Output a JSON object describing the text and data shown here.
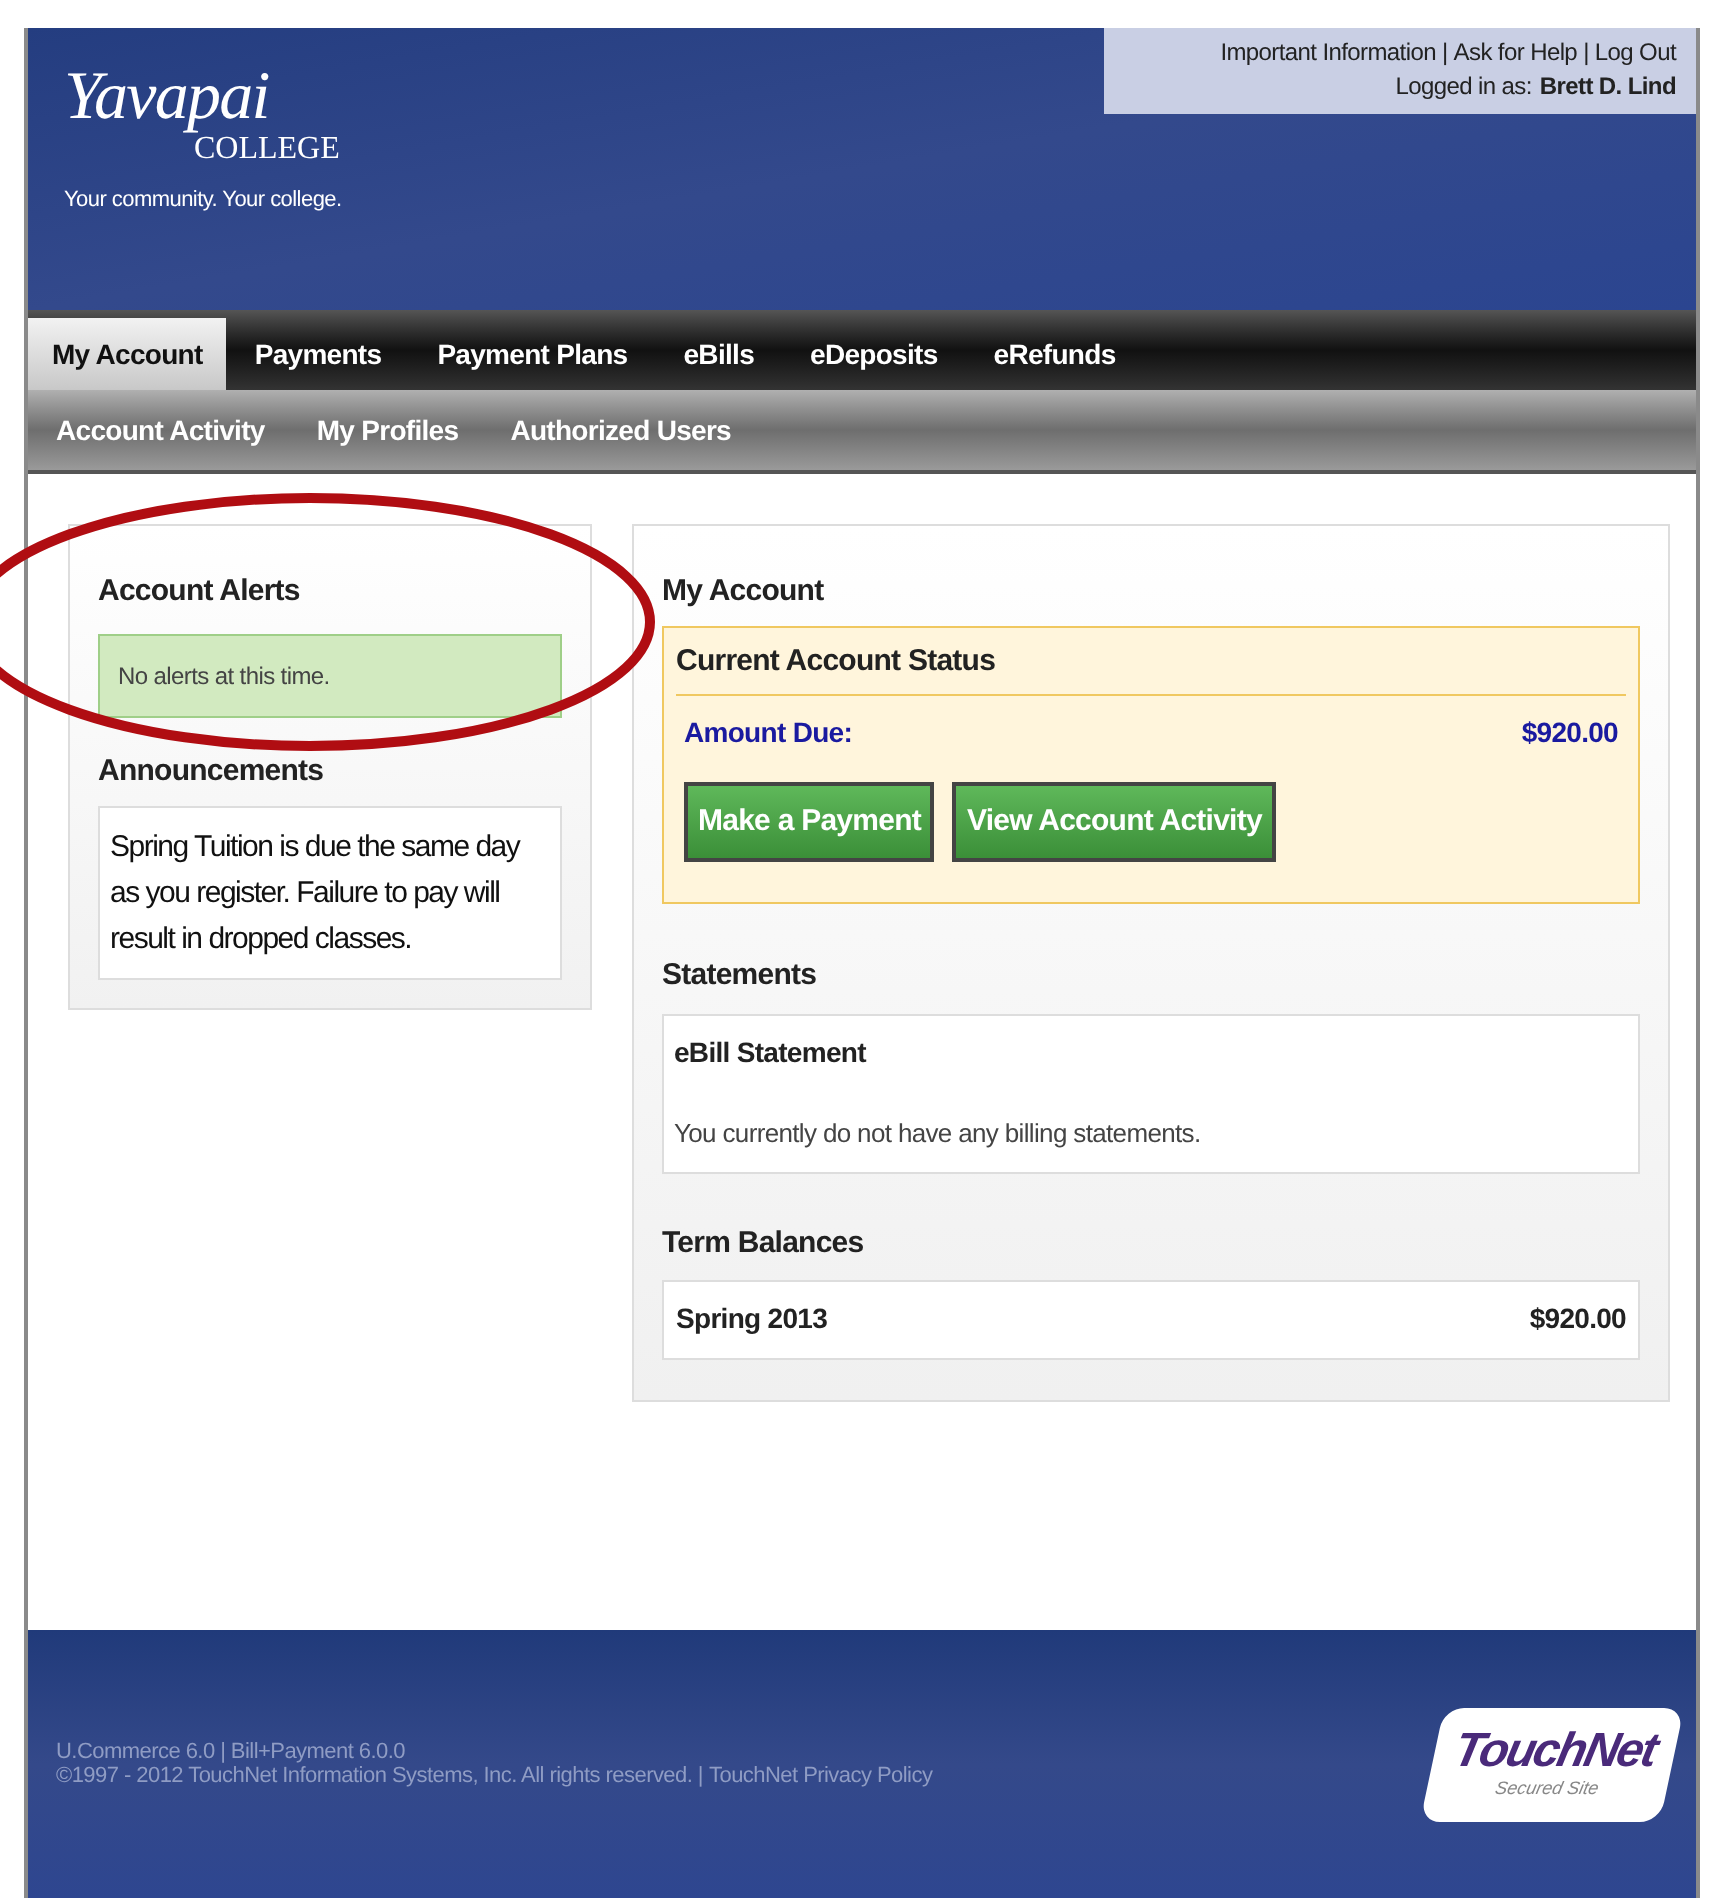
{
  "header": {
    "logo": {
      "name": "Yavapai",
      "sub": "COLLEGE",
      "tagline": "Your community. Your college."
    },
    "top_links": [
      "Important Information",
      "Ask for Help",
      "Log Out"
    ],
    "separator": "|",
    "logged_in_label": "Logged in as:",
    "user": "Brett D. Lind"
  },
  "nav_tabs": [
    {
      "label": "My Account",
      "selected": true
    },
    {
      "label": "Payments",
      "selected": false
    },
    {
      "label": "Payment Plans",
      "selected": false
    },
    {
      "label": "eBills",
      "selected": false
    },
    {
      "label": "eDeposits",
      "selected": false
    },
    {
      "label": "eRefunds",
      "selected": false
    }
  ],
  "sub_nav": [
    "Account Activity",
    "My Profiles",
    "Authorized Users"
  ],
  "left_panel": {
    "alerts_title": "Account Alerts",
    "alert": "No alerts at this time.",
    "announcements_title": "Announcements",
    "announcement": "Spring Tuition is due the same day as you register. Failure to pay will result in dropped classes."
  },
  "main_panel": {
    "title": "My Account",
    "status": {
      "title": "Current Account Status",
      "amount_label": "Amount Due:",
      "amount": "$920.00",
      "buttons": [
        "Make a Payment",
        "View Account Activity"
      ]
    },
    "statements": {
      "title": "Statements",
      "box_title": "eBill Statement",
      "message": "You currently do not have any billing statements."
    },
    "term_balances": {
      "title": "Term Balances",
      "rows": [
        {
          "term": "Spring 2013",
          "amount": "$920.00"
        }
      ]
    }
  },
  "footer": {
    "line_1": "U.Commerce 6.0 | Bill+Payment 6.0.0",
    "line_2": "©1997 - 2012 TouchNet Information Systems, Inc. All rights reserved. |",
    "privacy_link": "TouchNet Privacy Policy",
    "badge": {
      "name": "TouchNet",
      "sub": "Secured Site"
    }
  }
}
